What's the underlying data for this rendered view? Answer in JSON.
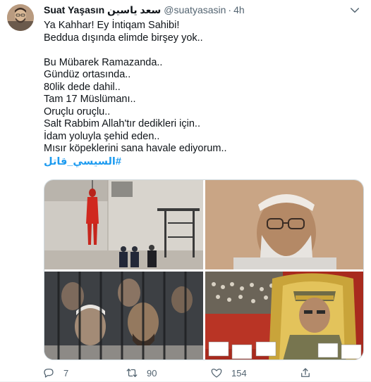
{
  "tweet": {
    "author_name": "Suat Yaşasın سعد ياسين",
    "handle": "@suatyasasin",
    "separator": "·",
    "time": "4h",
    "lines": [
      "Ya Kahhar! Ey İntiqam Sahibi!",
      "Beddua dışında elimde birşey yok..",
      "",
      "Bu Mübarek Ramazanda..",
      "Gündüz ortasında..",
      "80lik dede dahil..",
      "Tam 17 Müslümanı..",
      "Oruçlu oruçlu..",
      "Salt Rabbim Allah'tır dedikleri için..",
      "İdam yoluyla şehid eden..",
      "Mısır köpeklerini sana havale ediyorum.."
    ],
    "hashtag": "#السيسي_قاتل"
  },
  "actions": {
    "reply_count": "7",
    "retweet_count": "90",
    "like_count": "154"
  },
  "icons": {
    "more": "chevron-down-icon",
    "reply": "reply-icon",
    "retweet": "retweet-icon",
    "like": "heart-icon",
    "share": "share-icon"
  },
  "colors": {
    "text": "#0f1419",
    "secondary": "#536471",
    "link": "#1d9bf0"
  }
}
